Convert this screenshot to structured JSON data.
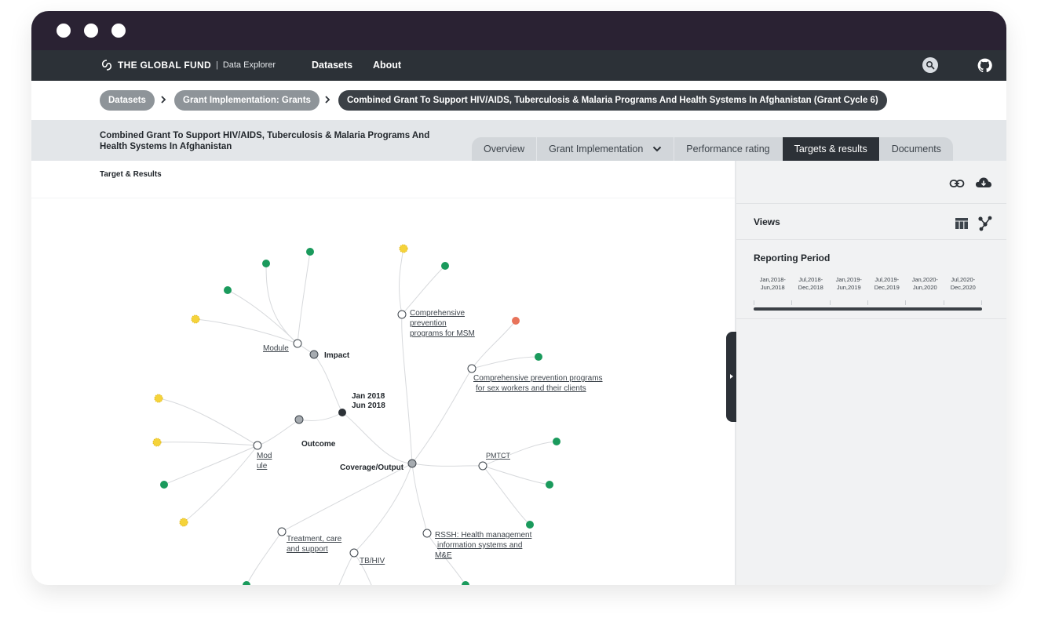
{
  "window": {
    "controls": [
      "close-dot",
      "minimize-dot",
      "maximize-dot"
    ]
  },
  "nav": {
    "brand": "THE GLOBAL FUND",
    "separator": "|",
    "product": "Data Explorer",
    "links": [
      "Datasets",
      "About"
    ]
  },
  "breadcrumb": [
    "Datasets",
    "Grant Implementation: Grants",
    "Combined Grant To Support HIV/AIDS, Tuberculosis & Malaria Programs And Health Systems In Afghanistan (Grant Cycle 6)"
  ],
  "grant": {
    "title_line1": "Combined Grant To Support HIV/AIDS, Tuberculosis & Malaria Programs And",
    "title_line2": "Health Systems In Afghanistan"
  },
  "tabs": [
    {
      "label": "Overview",
      "active": false
    },
    {
      "label": "Grant Implementation",
      "active": false,
      "dropdown": true
    },
    {
      "label": "Performance rating",
      "active": false
    },
    {
      "label": "Targets & results",
      "active": true
    },
    {
      "label": "Documents",
      "active": false
    }
  ],
  "main": {
    "section_label": "Target & Results"
  },
  "tree": {
    "root": {
      "line1": "Jan 2018",
      "line2": "Jun 2018"
    },
    "groups": [
      "Impact",
      "Outcome",
      "Coverage/Output"
    ],
    "modules": {
      "impact_module": "Module",
      "outcome_module_line1": "Mod",
      "outcome_module_line2": "ule",
      "msm_line1": "Comprehensive",
      "msm_line2": "prevention",
      "msm_line3": "programs for MSM",
      "sw_line1": "Comprehensive prevention programs",
      "sw_line2": "for sex workers and their clients",
      "pmtct": "PMTCT",
      "rssh_line1": "RSSH: Health management",
      "rssh_line2": "information systems and",
      "rssh_line3": "M&E",
      "treatment_line1": "Treatment, care",
      "treatment_line2": "and support",
      "tbhiv": "TB/HIV"
    },
    "colors": {
      "green": "#1a9a5c",
      "yellow": "#f5d33a",
      "red": "#e8735a",
      "gray": "#a6abb0",
      "dark": "#2c3137"
    }
  },
  "side": {
    "views_label": "Views",
    "reporting_label": "Reporting Period",
    "periods": [
      {
        "line1": "Jan,2018-",
        "line2": "Jun,2018"
      },
      {
        "line1": "Jul,2018-",
        "line2": "Dec,2018"
      },
      {
        "line1": "Jan,2019-",
        "line2": "Jun,2019"
      },
      {
        "line1": "Jul,2019-",
        "line2": "Dec,2019"
      },
      {
        "line1": "Jan,2020-",
        "line2": "Jun,2020"
      },
      {
        "line1": "Jul,2020-",
        "line2": "Dec,2020"
      }
    ]
  },
  "icons": [
    "logo-mark-icon",
    "search-icon",
    "github-icon",
    "chevron-right-icon",
    "chevron-down-icon",
    "link-icon",
    "cloud-download-icon",
    "table-view-icon",
    "tree-view-icon",
    "panel-toggle-icon"
  ]
}
